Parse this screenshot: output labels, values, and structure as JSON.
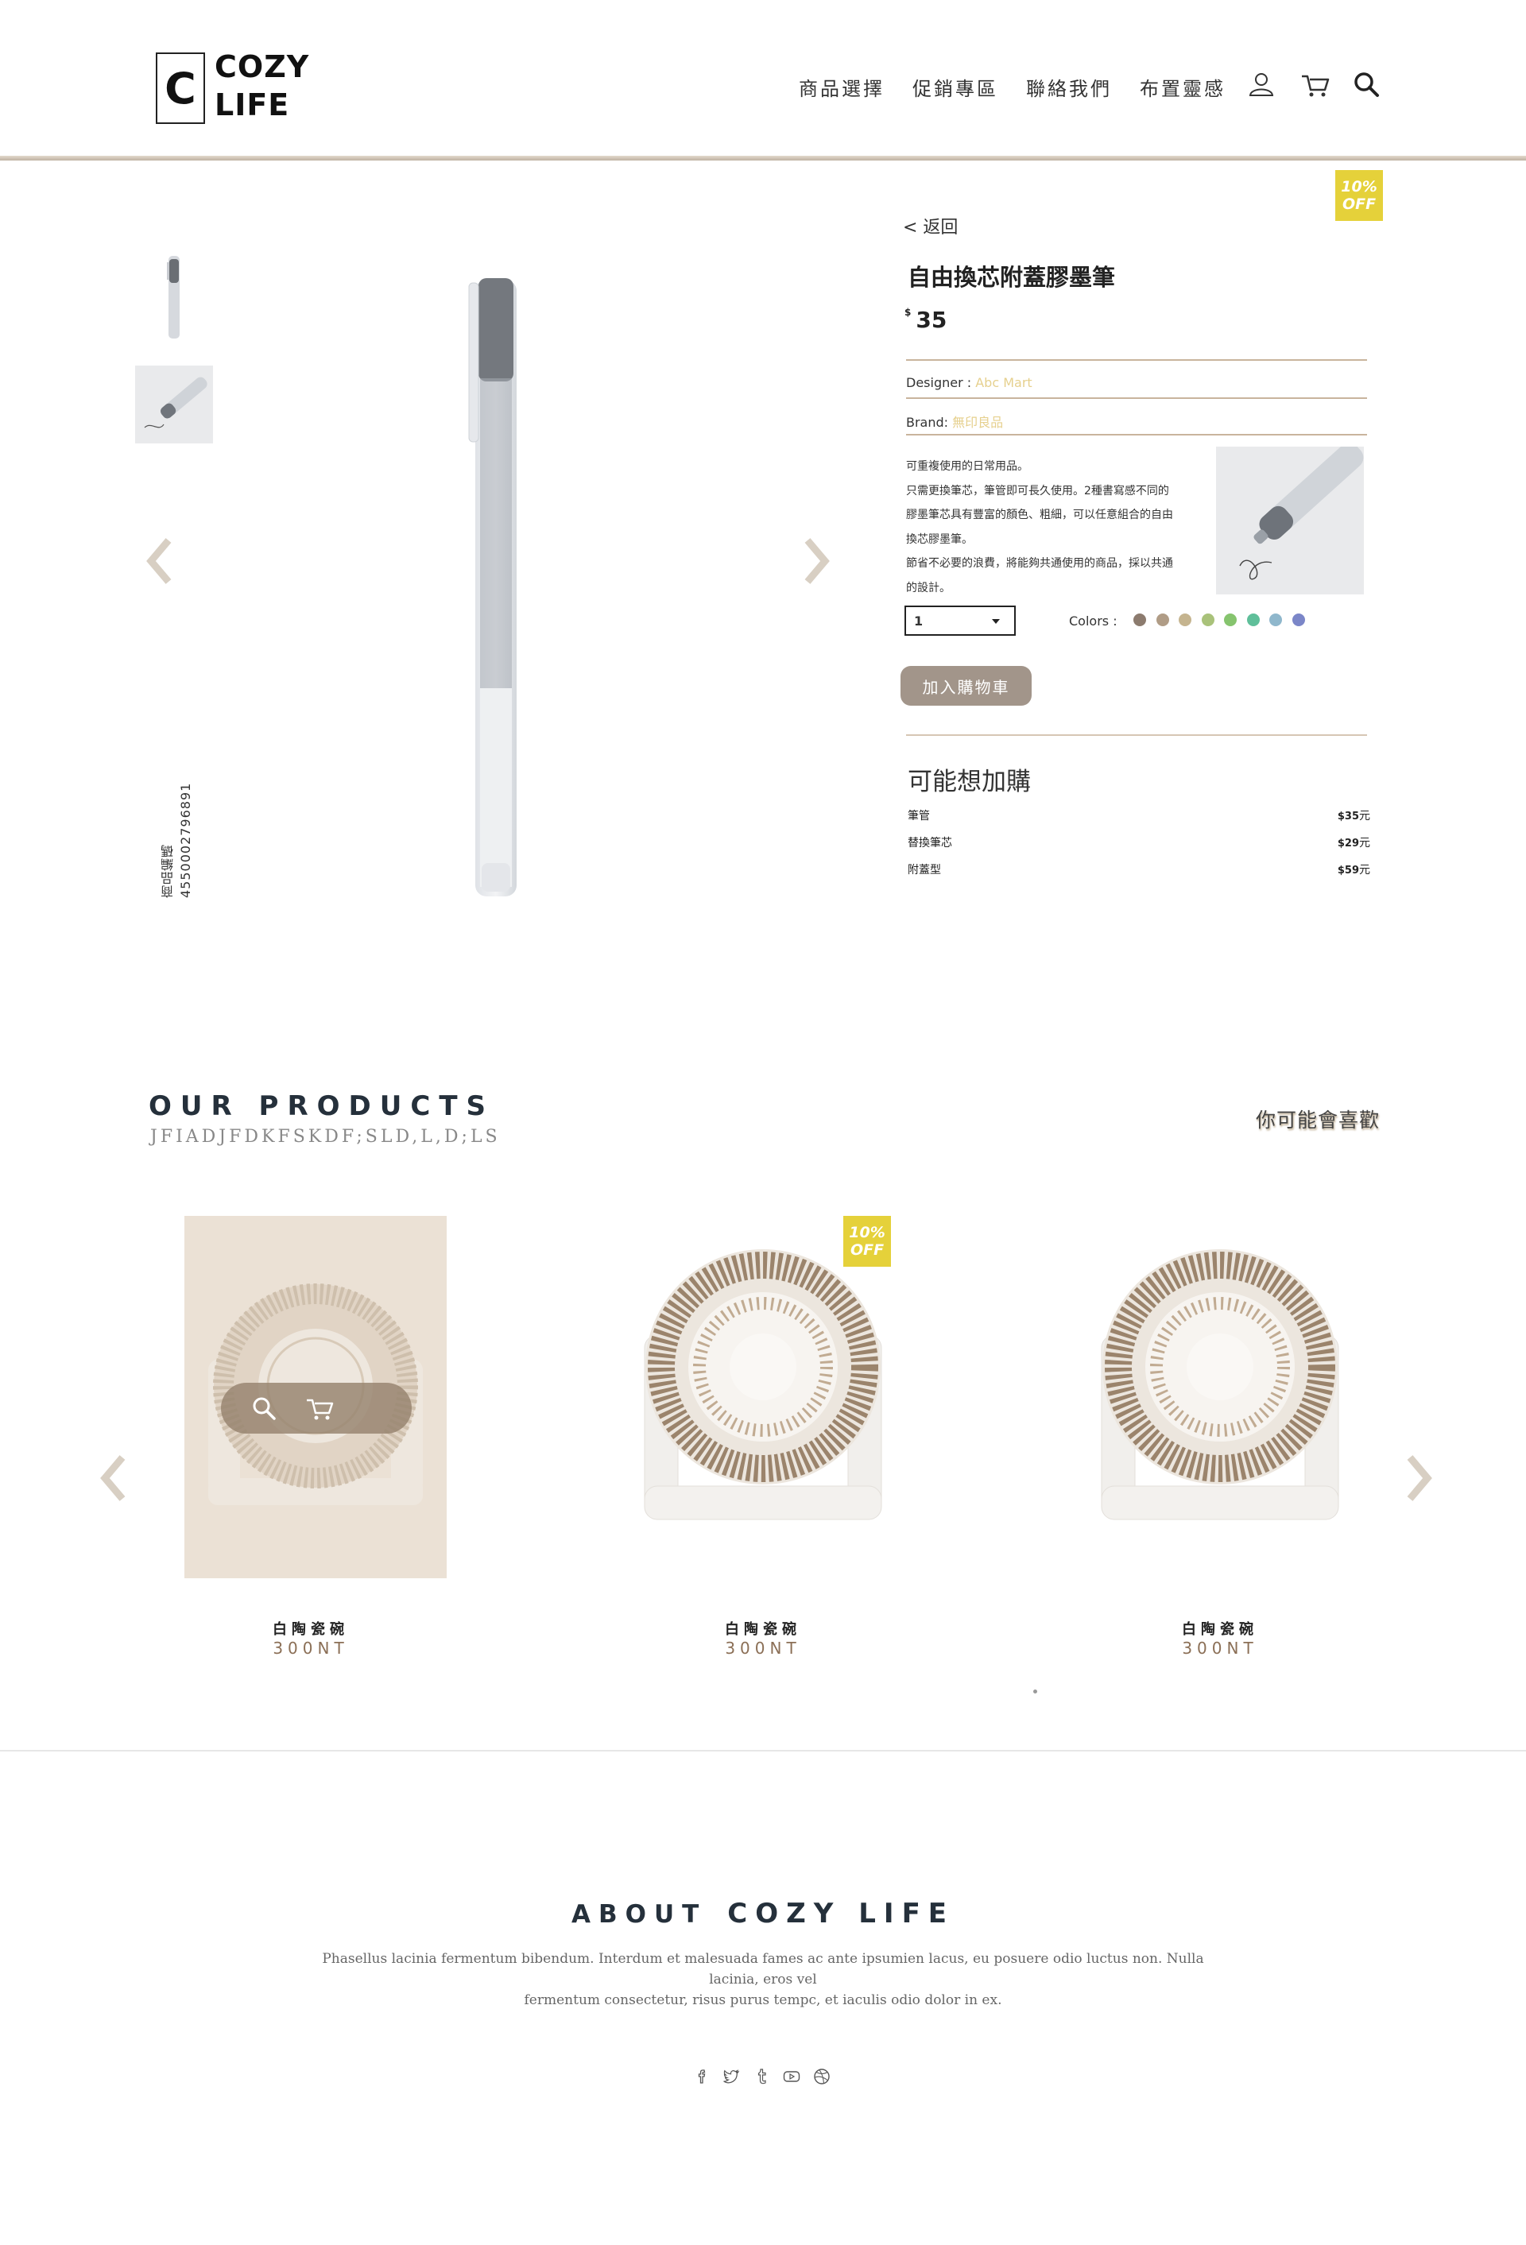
{
  "header": {
    "logo_letter": "C",
    "logo_line1": "COZY",
    "logo_line2": "LIFE",
    "nav": [
      "商品選擇",
      "促銷專區",
      "聯絡我們",
      "布置靈感"
    ],
    "icons": [
      "user-icon",
      "cart-icon",
      "search-icon"
    ]
  },
  "product": {
    "back": "< 返回",
    "badge_line1": "10%",
    "badge_line2": "OFF",
    "title": "自由換芯附蓋膠墨筆",
    "currency": "$",
    "price": "35",
    "designer_label": "Designer : ",
    "designer_value": "Abc Mart",
    "brand_label": "Brand: ",
    "brand_value": "無印良品",
    "description": [
      "可重複使用的日常用品。",
      "只需更換筆芯，筆管即可長久使用。2種書寫感不同的",
      "膠墨筆芯具有豐富的顏色、粗細，可以任意組合的自由",
      "換芯膠墨筆。",
      "節省不必要的浪費，將能夠共通使用的商品，採以共通",
      "的設計。"
    ],
    "quantity": "1",
    "colors_label": "Colors :",
    "colors": [
      "#8c7b6e",
      "#b09c86",
      "#c5b48f",
      "#a9c27a",
      "#86c46e",
      "#5fbf9a",
      "#8fb7cc",
      "#7b86c8"
    ],
    "add_to_cart": "加入購物車",
    "sku": "商品編碼4550002796891"
  },
  "addons": {
    "title": "可能想加購",
    "items": [
      {
        "name": "筆管",
        "price": "$35",
        "unit": "元"
      },
      {
        "name": "替換筆芯",
        "price": "$29",
        "unit": "元"
      },
      {
        "name": "附蓋型",
        "price": "$59",
        "unit": "元"
      }
    ]
  },
  "products_section": {
    "title": "OUR PRODUCTS",
    "subtitle": "JFIADJFDKFSKDF;SLD,L,D;LS",
    "right_label": "你可能會喜歡",
    "cards": [
      {
        "name": "白陶瓷碗",
        "price": "300NT",
        "badge": ""
      },
      {
        "name": "白陶瓷碗",
        "price": "300NT",
        "badge": "10%|OFF"
      },
      {
        "name": "白陶瓷碗",
        "price": "300NT",
        "badge": ""
      }
    ],
    "badge_line1": "10%",
    "badge_line2": "OFF"
  },
  "about": {
    "title_word1": "ABOUT",
    "title_word2": "COZY LIFE",
    "text_line1": "Phasellus lacinia fermentum bibendum. Interdum et malesuada fames ac ante ipsumien lacus, eu posuere odio luctus non. Nulla lacinia, eros vel",
    "text_line2": "fermentum consectetur, risus purus tempc, et iaculis odio dolor in ex.",
    "social": [
      "facebook-icon",
      "twitter-icon",
      "tumblr-icon",
      "youtube-icon",
      "dribbble-icon"
    ]
  }
}
